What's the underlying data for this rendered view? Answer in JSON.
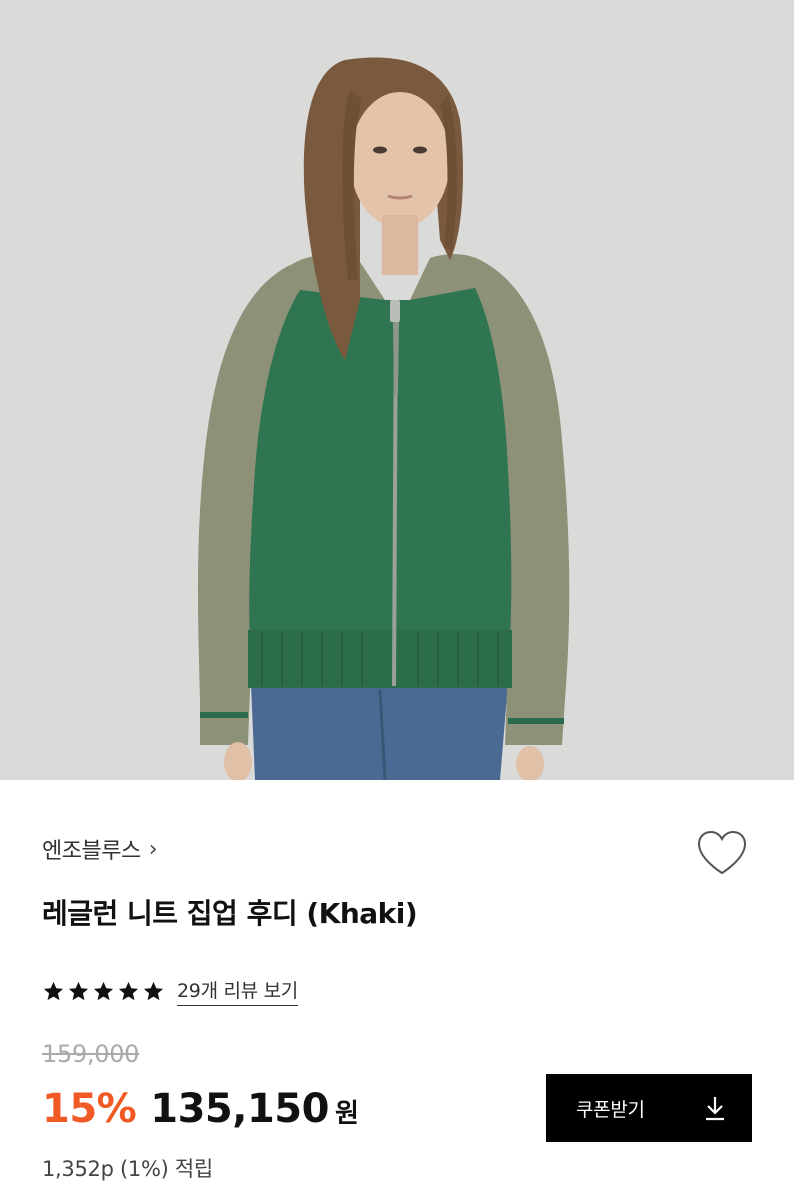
{
  "product_image": {
    "alt": "model wearing green and khaki raglan knit zip-up hoodie"
  },
  "brand": {
    "name": "엔조블루스",
    "chevron": "›"
  },
  "wishlist": {
    "icon": "heart-outline-icon"
  },
  "product": {
    "title": "레글런 니트 집업 후디 (Khaki)"
  },
  "rating": {
    "stars": 5,
    "review_link": "29개 리뷰 보기"
  },
  "pricing": {
    "original": "159,000",
    "discount": "15%",
    "sale": "135,150",
    "currency": "원",
    "points": "1,352p (1%) 적립"
  },
  "coupon": {
    "label": "쿠폰받기",
    "icon": "download-icon"
  },
  "colors": {
    "discount": "#f15a24",
    "button": "#000000",
    "strike": "#aaaaaa"
  }
}
